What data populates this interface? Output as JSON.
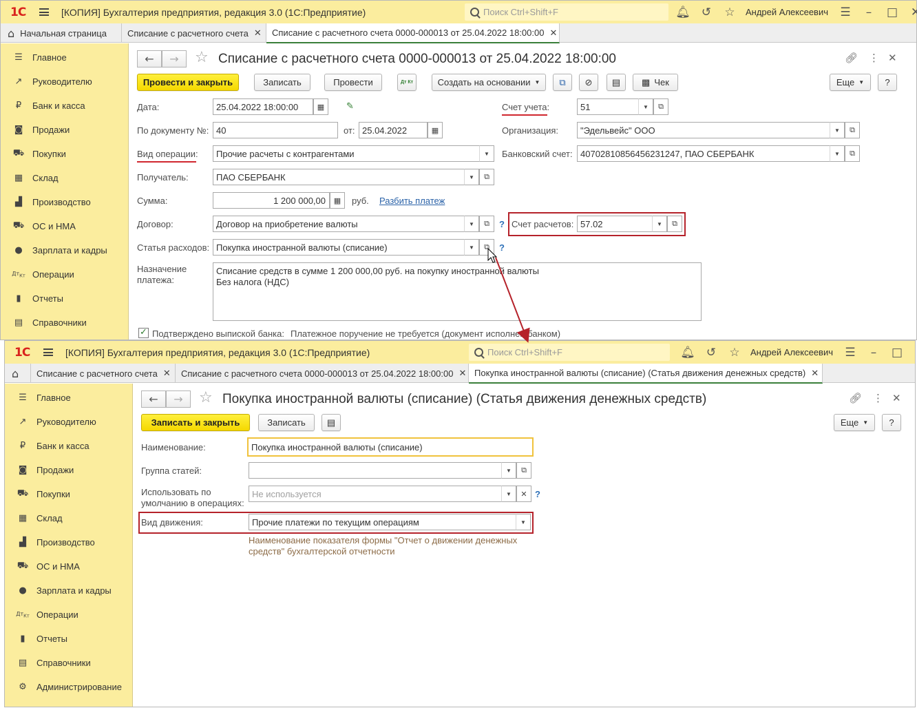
{
  "app": {
    "logo": "1С",
    "title": "[КОПИЯ] Бухгалтерия предприятия, редакция 3.0  (1С:Предприятие)",
    "search_placeholder": "Поиск Ctrl+Shift+F",
    "user": "Андрей Алексеевич",
    "accent_color": "#fbed9e"
  },
  "window1": {
    "tabs": [
      "Начальная страница",
      "Списание с расчетного счета",
      "Списание с расчетного счета 0000-000013 от 25.04.2022 18:00:00"
    ],
    "sidebar": [
      "Главное",
      "Руководителю",
      "Банк и касса",
      "Продажи",
      "Покупки",
      "Склад",
      "Производство",
      "ОС и НМА",
      "Зарплата и кадры",
      "Операции",
      "Отчеты",
      "Справочники"
    ],
    "doc_title": "Списание с расчетного счета 0000-000013 от 25.04.2022 18:00:00",
    "toolbar": {
      "post_close": "Провести и закрыть",
      "save": "Записать",
      "post": "Провести",
      "dtkt": "Дт Кт",
      "create_based": "Создать на основании",
      "receipt": "Чек",
      "more": "Еще",
      "help": "?"
    },
    "form": {
      "date_label": "Дата:",
      "date_value": "25.04.2022 18:00:00",
      "docnum_label": "По документу №:",
      "docnum_value": "40",
      "from_label": "от:",
      "from_value": "25.04.2022",
      "optype_label": "Вид операции:",
      "optype_value": "Прочие расчеты с контрагентами",
      "recipient_label": "Получатель:",
      "recipient_value": "ПАО СБЕРБАНК",
      "sum_label": "Сумма:",
      "sum_value": "1 200 000,00",
      "currency": "руб.",
      "split_link": "Разбить платеж",
      "contract_label": "Договор:",
      "contract_value": "Договор на приобретение валюты",
      "expense_label": "Статья расходов:",
      "expense_value": "Покупка иностранной валюты (списание)",
      "purpose_label": "Назначение\nплатежа:",
      "purpose_value": "Списание средств в сумме 1 200 000,00 руб. на покупку иностранной валюты\nБез налога (НДС)",
      "account_label": "Счет учета:",
      "account_value": "51",
      "org_label": "Организация:",
      "org_value": "\"Эдельвейс\" ООО",
      "bank_label": "Банковский счет:",
      "bank_value": "40702810856456231247, ПАО СБЕРБАНК",
      "settle_label": "Счет расчетов:",
      "settle_value": "57.02",
      "confirmed_label": "Подтверждено выпиской банка:",
      "confirmed_note": "Платежное поручение не требуется (документ исполнен банком)",
      "help": "?"
    }
  },
  "window2": {
    "tabs": [
      "Списание с расчетного счета",
      "Списание с расчетного счета 0000-000013 от 25.04.2022 18:00:00",
      "Покупка иностранной валюты (списание) (Статья движения денежных средств)"
    ],
    "sidebar": [
      "Главное",
      "Руководителю",
      "Банк и касса",
      "Продажи",
      "Покупки",
      "Склад",
      "Производство",
      "ОС и НМА",
      "Зарплата и кадры",
      "Операции",
      "Отчеты",
      "Справочники",
      "Администрирование"
    ],
    "doc_title": "Покупка иностранной валюты (списание) (Статья движения денежных средств)",
    "toolbar": {
      "save_close": "Записать и закрыть",
      "save": "Записать",
      "more": "Еще",
      "help": "?"
    },
    "form": {
      "name_label": "Наименование:",
      "name_value": "Покупка иностранной валюты (списание)",
      "group_label": "Группа статей:",
      "group_value": "",
      "default_label": "Использовать по\nумолчанию в операциях:",
      "default_placeholder": "Не используется",
      "movement_label": "Вид движения:",
      "movement_value": "Прочие платежи по текущим операциям",
      "hint": "Наименование показателя формы \"Отчет о движении денежных\nсредств\" бухгалтерской отчетности",
      "help": "?"
    }
  }
}
